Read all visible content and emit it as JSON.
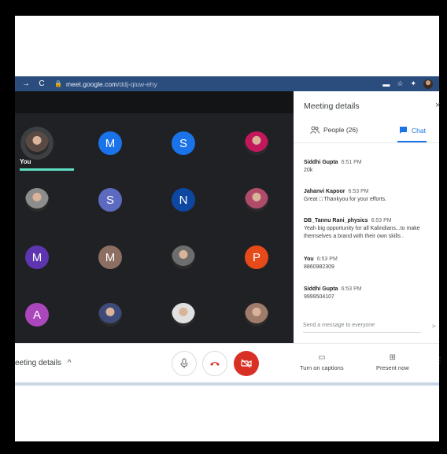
{
  "browser": {
    "nav_forward": "→",
    "nav_reload": "C",
    "url_host": "meet.google.com",
    "url_path": "/ddj-qiuw-ehy"
  },
  "grid": {
    "you_label": "You",
    "tiles": [
      {
        "kind": "photo",
        "color": "#5a4a43"
      },
      {
        "kind": "letter",
        "letter": "M",
        "color": "#1a73e8"
      },
      {
        "kind": "letter",
        "letter": "S",
        "color": "#1a73e8"
      },
      {
        "kind": "photo",
        "color": "#c2185b"
      },
      {
        "kind": "photo",
        "color": "#8d8d8d"
      },
      {
        "kind": "letter",
        "letter": "S",
        "color": "#5c6bc0"
      },
      {
        "kind": "letter",
        "letter": "N",
        "color": "#0d47a1"
      },
      {
        "kind": "photo",
        "color": "#b04b6a"
      },
      {
        "kind": "letter",
        "letter": "M",
        "color": "#5e35b1"
      },
      {
        "kind": "letter",
        "letter": "M",
        "color": "#8d6e63"
      },
      {
        "kind": "photo",
        "color": "#6d6d6d"
      },
      {
        "kind": "letter",
        "letter": "P",
        "color": "#e64a19"
      },
      {
        "kind": "letter",
        "letter": "A",
        "color": "#ab47bc"
      },
      {
        "kind": "photo",
        "color": "#3e4a7a"
      },
      {
        "kind": "photo",
        "color": "#e0e0e0"
      },
      {
        "kind": "photo",
        "color": "#9e7b6b"
      }
    ]
  },
  "panel": {
    "title": "Meeting details",
    "close": "×",
    "people_tab": "People (26)",
    "chat_tab": "Chat",
    "messages": [
      {
        "sender": "Siddhi Gupta",
        "time": "6:51 PM",
        "text": "20k"
      },
      {
        "sender": "Jahanvi Kapoor",
        "time": "6:53 PM",
        "text": "Great □ Thankyou for your efforts."
      },
      {
        "sender": "DB_Tannu Rani_physics",
        "time": "6:53 PM",
        "text": "Yeah big opportunity for all Kalindians...to make themselves a brand with their own skills ."
      },
      {
        "sender": "You",
        "time": "6:53 PM",
        "text": "8860982309"
      },
      {
        "sender": "Siddhi Gupta",
        "time": "6:53 PM",
        "text": "9999504107"
      }
    ],
    "compose_placeholder": "Send a message to everyone"
  },
  "controls": {
    "meeting_details": "eeting details",
    "captions_label": "Turn on captions",
    "present_label": "Present now"
  },
  "colors": {
    "accent": "#1a73e8",
    "hangup_red": "#d93025",
    "speaker_bar": "#5fe0c4"
  }
}
